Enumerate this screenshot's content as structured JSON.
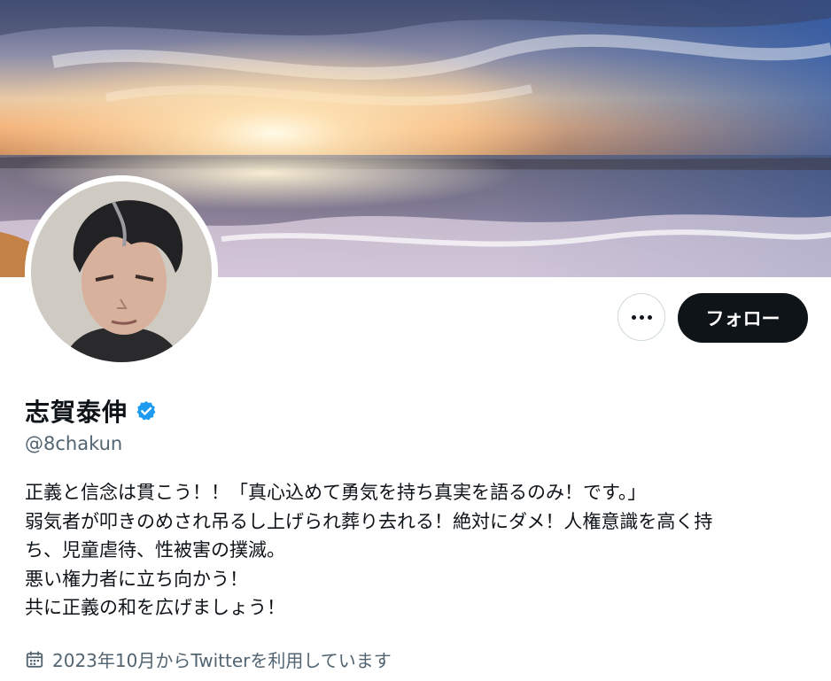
{
  "profile": {
    "display_name": "志賀泰伸",
    "handle": "@8chakun",
    "verified": true,
    "bio_lines": [
      "正義と信念は貫こう！！「真心込めて勇気を持ち真実を語るのみ！です。」",
      "弱気者が叩きのめされ吊るし上げられ葬り去れる！絶対にダメ！人権意識を高く持",
      "ち、児童虐待、性被害の撲滅。",
      "悪い権力者に立ち向かう！",
      "共に正義の和を広げましょう！"
    ],
    "joined": "2023年10月からTwitterを利用しています"
  },
  "actions": {
    "follow_label": "フォロー",
    "more_icon": "more-horizontal-icon"
  },
  "icons": {
    "verified": "verified-badge-icon",
    "calendar": "calendar-icon"
  },
  "colors": {
    "text": "#0f1419",
    "secondary": "#536471",
    "verified_blue": "#1d9bf0",
    "button_dark": "#0f1419",
    "border": "#cfd9de"
  }
}
